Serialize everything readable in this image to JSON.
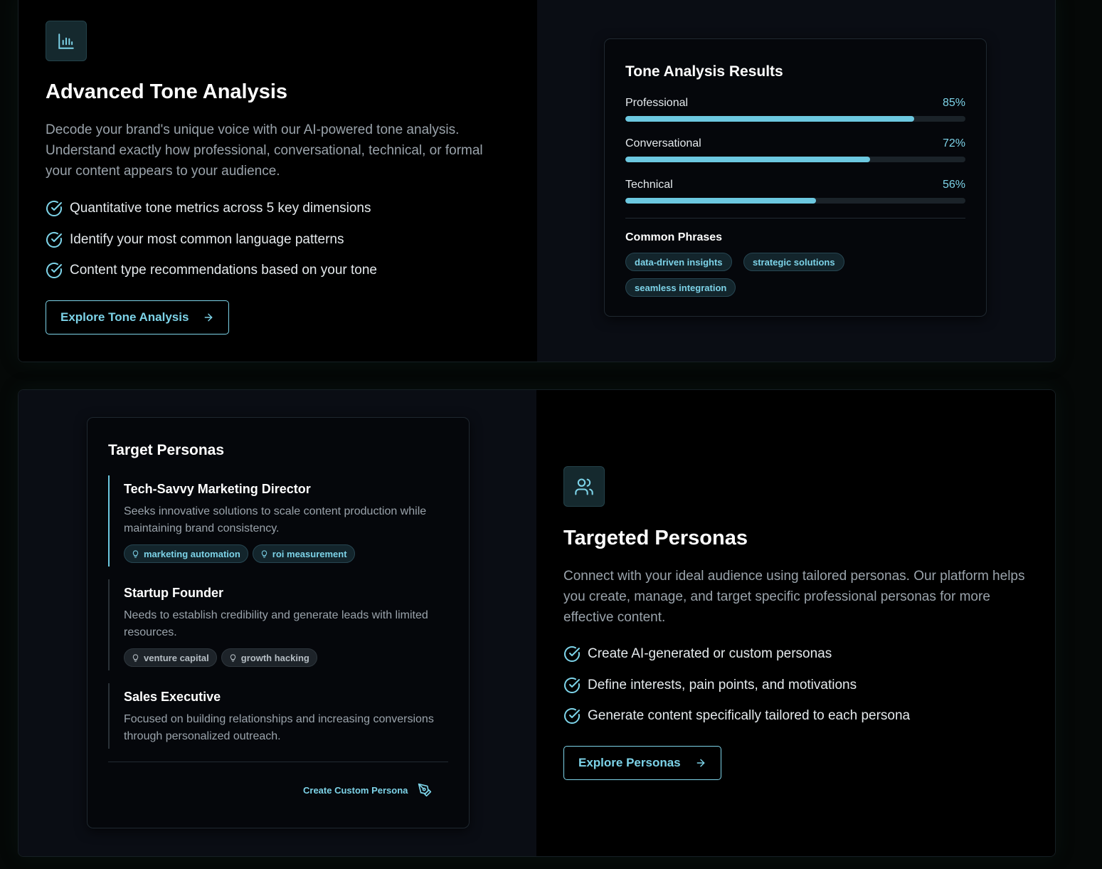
{
  "tone_feature": {
    "icon": "bar-chart-icon",
    "title": "Advanced Tone Analysis",
    "description": "Decode your brand's unique voice with our AI-powered tone analysis. Understand exactly how professional, conversational, technical, or formal your content appears to your audience.",
    "bullets": [
      "Quantitative tone metrics across 5 key dimensions",
      "Identify your most common language patterns",
      "Content type recommendations based on your tone"
    ],
    "button_label": "Explore Tone Analysis"
  },
  "tone_card": {
    "title": "Tone Analysis Results",
    "metrics": [
      {
        "label": "Professional",
        "value_text": "85%",
        "value": 85
      },
      {
        "label": "Conversational",
        "value_text": "72%",
        "value": 72
      },
      {
        "label": "Technical",
        "value_text": "56%",
        "value": 56
      }
    ],
    "phrases_title": "Common Phrases",
    "phrases": [
      "data-driven insights",
      "strategic solutions",
      "seamless integration"
    ]
  },
  "personas_card": {
    "title": "Target Personas",
    "personas": [
      {
        "name": "Tech-Savvy Marketing Director",
        "description": "Seeks innovative solutions to scale content production while maintaining brand consistency.",
        "tags": [
          "marketing automation",
          "roi measurement"
        ]
      },
      {
        "name": "Startup Founder",
        "description": "Needs to establish credibility and generate leads with limited resources.",
        "tags": [
          "venture capital",
          "growth hacking"
        ]
      },
      {
        "name": "Sales Executive",
        "description": "Focused on building relationships and increasing conversions through personalized outreach.",
        "tags": []
      }
    ],
    "create_label": "Create Custom Persona"
  },
  "persona_feature": {
    "icon": "users-icon",
    "title": "Targeted Personas",
    "description": "Connect with your ideal audience using tailored personas. Our platform helps you create, manage, and target specific professional personas for more effective content.",
    "bullets": [
      "Create AI-generated or custom personas",
      "Define interests, pain points, and motivations",
      "Generate content specifically tailored to each persona"
    ],
    "button_label": "Explore Personas"
  },
  "colors": {
    "accent": "#7dd3e8",
    "bar": "#6cc8e0",
    "navy_panel": "#0a0d14",
    "black_panel": "#000000"
  }
}
